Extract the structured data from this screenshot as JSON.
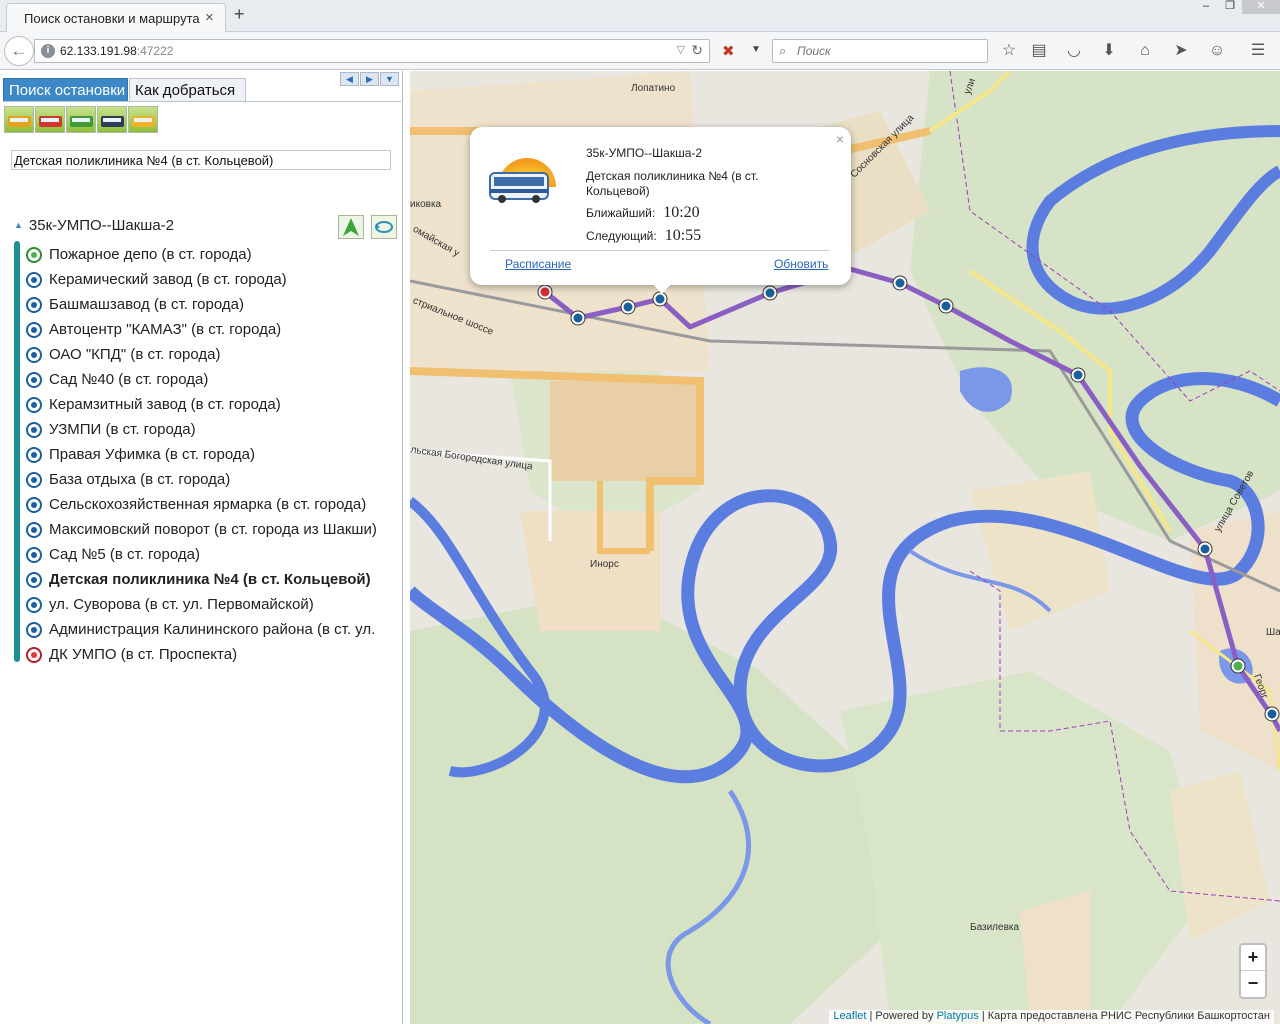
{
  "browser": {
    "tab_title": "Поиск остановки и маршрута",
    "tab_close": "×",
    "new_tab": "+",
    "url_host": "62.133.191.98",
    "url_port": ":47222",
    "search_placeholder": "Поиск",
    "window_buttons": [
      "–",
      "❐",
      "✕"
    ]
  },
  "panel": {
    "tabs": [
      "Поиск остановки",
      "Как добраться"
    ],
    "vehicle_types": [
      "bus",
      "tram",
      "trolleybus",
      "suburban-bus",
      "minibus"
    ],
    "stop_query": "Детская поликлиника №4 (в ст. Кольцевой)",
    "route_name": "35к-УМПО--Шакша-2",
    "stops": [
      {
        "name": "Пожарное депо (в ст. города)",
        "status": "start"
      },
      {
        "name": "Керамический завод (в ст. города)",
        "status": "normal"
      },
      {
        "name": "Башмашзавод (в ст. города)",
        "status": "normal"
      },
      {
        "name": "Автоцентр \"КАМАЗ\" (в ст. города)",
        "status": "normal"
      },
      {
        "name": "ОАО \"КПД\" (в ст. города)",
        "status": "normal"
      },
      {
        "name": "Сад №40 (в ст. города)",
        "status": "normal"
      },
      {
        "name": "Керамзитный завод (в ст. города)",
        "status": "normal"
      },
      {
        "name": "УЗМПИ (в ст. города)",
        "status": "normal"
      },
      {
        "name": "Правая Уфимка (в ст. города)",
        "status": "normal"
      },
      {
        "name": "База отдыха (в ст. города)",
        "status": "normal"
      },
      {
        "name": "Сельскохозяйственная ярмарка (в ст. города)",
        "status": "normal"
      },
      {
        "name": "Максимовский поворот (в ст. города из Шакши)",
        "status": "normal"
      },
      {
        "name": "Сад №5 (в ст. города)",
        "status": "normal"
      },
      {
        "name": "Детская поликлиника №4 (в ст. Кольцевой)",
        "status": "selected"
      },
      {
        "name": "ул. Суворова (в ст. ул. Первомайской)",
        "status": "normal"
      },
      {
        "name": "Администрация Калининского района (в ст. ул. Первомайской)",
        "status": "normal"
      },
      {
        "name": "ДК УМПО (в ст. Проспекта)",
        "status": "end"
      }
    ]
  },
  "popup": {
    "route": "35к-УМПО--Шакша-2",
    "stop": "Детская поликлиника №4 (в ст. Кольцевой)",
    "nearest_label": "Ближайший:",
    "nearest_time": "10:20",
    "next_label": "Следующий:",
    "next_time": "10:55",
    "schedule_link": "Расписание",
    "refresh_link": "Обновить",
    "close": "×"
  },
  "map": {
    "labels": {
      "lopatino": "Лопатино",
      "sosnovskaya": "Сосновская улица",
      "ikovka": "иковка",
      "romaiskaya": "омайская у",
      "industrial": "стриальное шоссе",
      "bogorodskaya": "льская Богородская улица",
      "inors": "Инорс",
      "sovetov": "улица Советов",
      "shak": "Шак",
      "bazilevka": "Базилевка",
      "georg": "Георг",
      "uli": "ули"
    },
    "zoom_in": "+",
    "zoom_out": "−",
    "attribution": {
      "leaflet": "Leaflet",
      "powered": " | Powered by ",
      "platypus": "Platypus",
      "provider": " | Карта предоставлена РНИС Республики Башкортостан"
    }
  },
  "colors": {
    "route": "#8a5fc4",
    "river": "#5b7de0",
    "road_major": "#f0c070",
    "accent": "#3d88c6"
  }
}
